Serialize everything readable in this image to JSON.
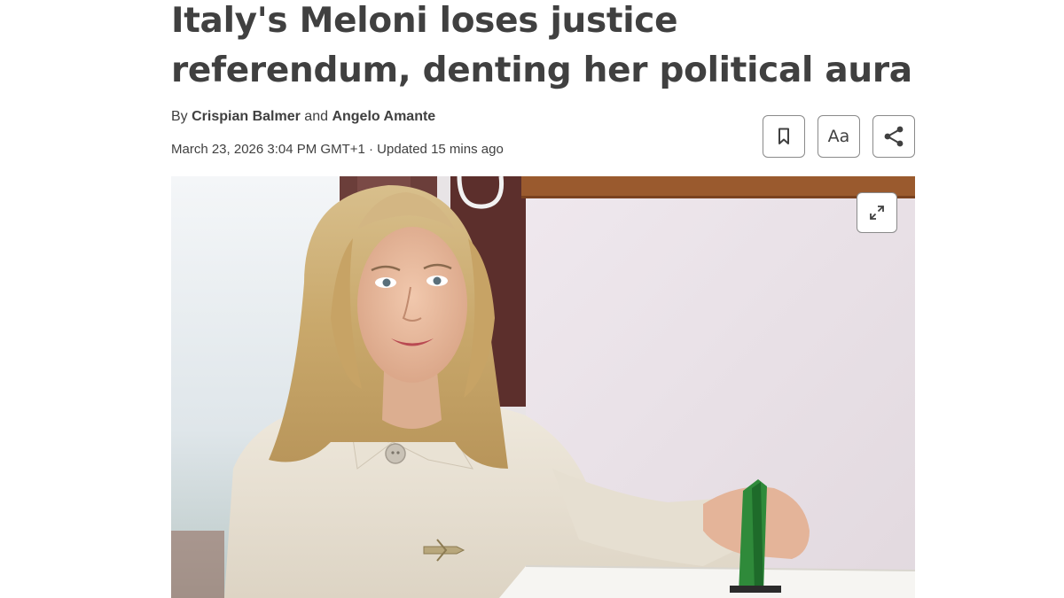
{
  "article": {
    "headline": "Italy's Meloni loses justice referendum, denting her political aura",
    "byline": {
      "prefix": "By",
      "author1": "Crispian Balmer",
      "conjunction": "and",
      "author2": "Angelo Amante"
    },
    "dateline": "March 23, 2026 3:04 PM GMT+1 · Updated 15 mins ago"
  },
  "tools": {
    "bookmark_icon": "bookmark-icon",
    "text_size_label": "Aa",
    "share_icon": "share-icon"
  },
  "hero": {
    "expand_icon": "expand-icon"
  }
}
